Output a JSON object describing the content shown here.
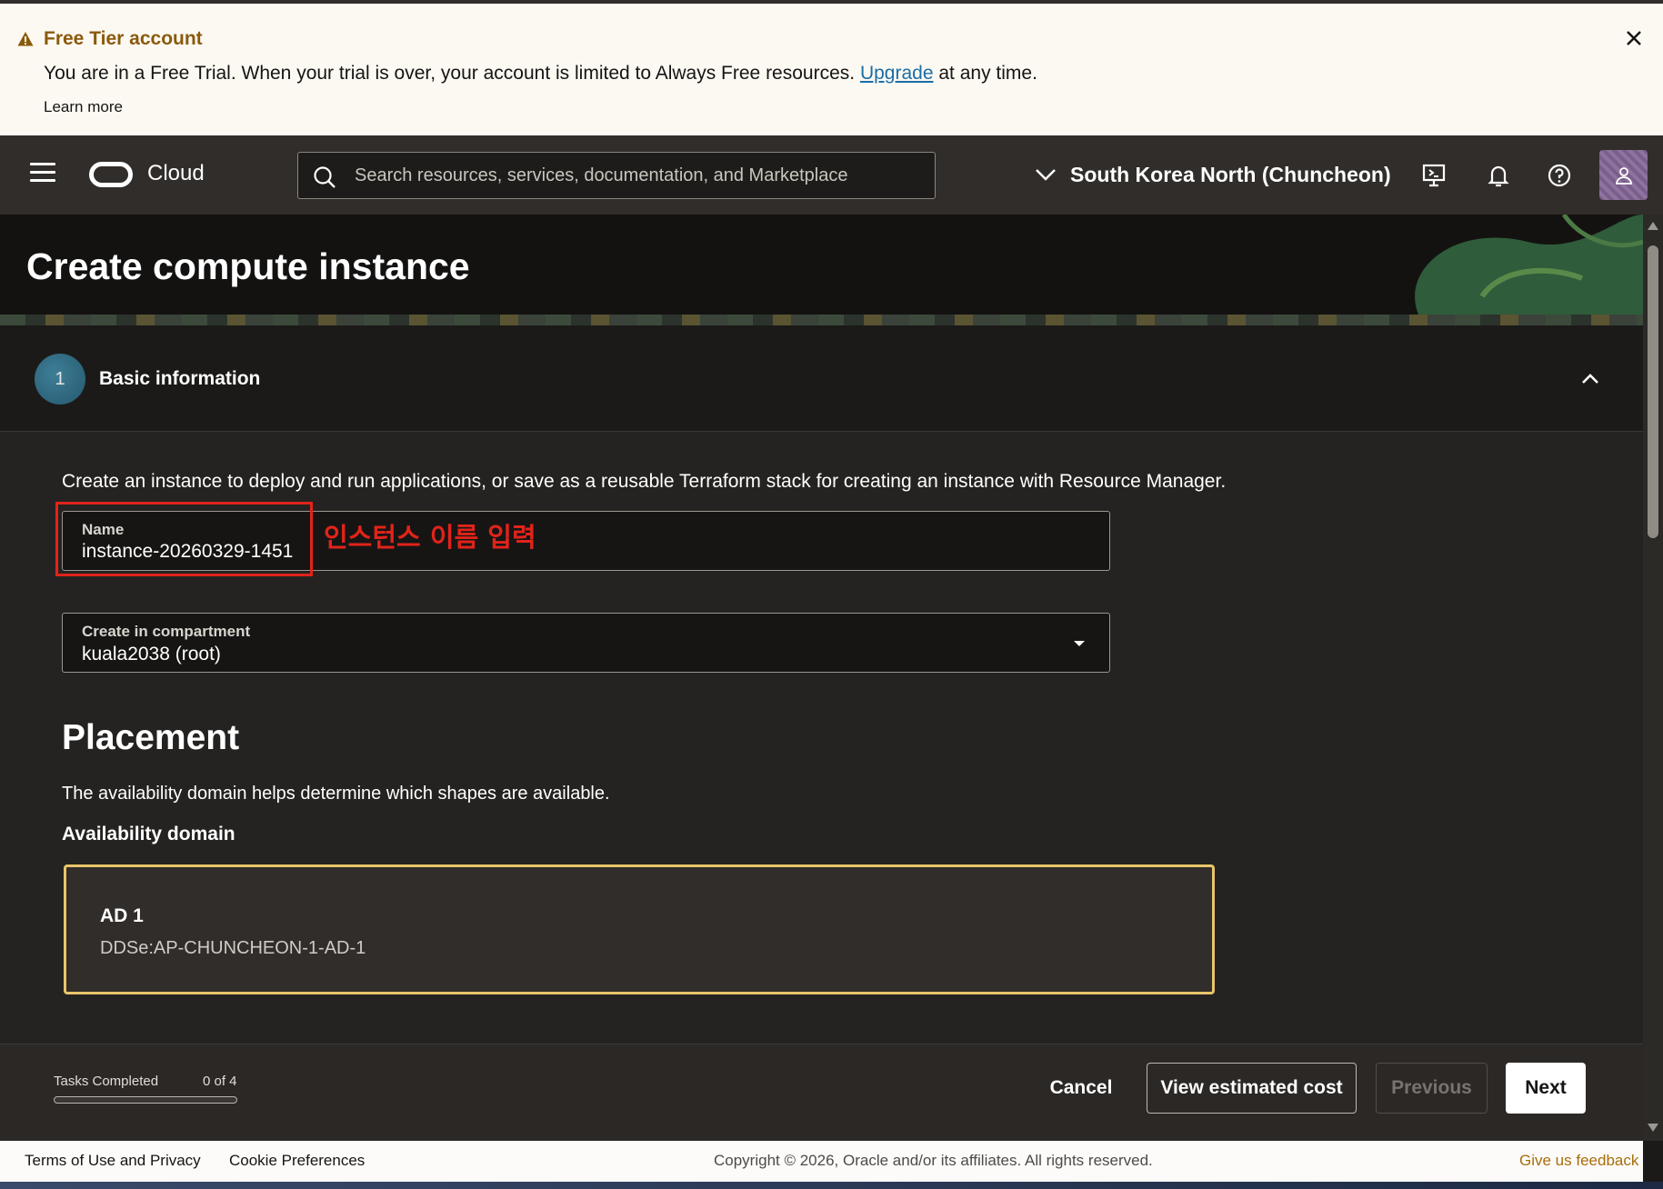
{
  "banner": {
    "title": "Free Tier account",
    "message_before": "You are in a Free Trial. When your trial is over, your account is limited to Always Free resources.",
    "upgrade_link": "Upgrade",
    "message_after": "at any time.",
    "learn_more": "Learn more"
  },
  "header": {
    "brand": "Cloud",
    "search_placeholder": "Search resources, services, documentation, and Marketplace",
    "region": "South Korea North (Chuncheon)"
  },
  "page": {
    "title": "Create compute instance"
  },
  "section": {
    "step_number": "1",
    "label": "Basic information"
  },
  "form": {
    "intro": "Create an instance to deploy and run applications, or save as a reusable Terraform stack for creating an instance with Resource Manager.",
    "name_label": "Name",
    "name_value": "instance-20260329-1451",
    "annotation": "인스턴스 이름 입력",
    "compartment_label": "Create in compartment",
    "compartment_value": "kuala2038 (root)"
  },
  "placement": {
    "heading": "Placement",
    "description": "The availability domain helps determine which shapes are available.",
    "ad_label": "Availability domain",
    "ad_name": "AD 1",
    "ad_id": "DDSe:AP-CHUNCHEON-1-AD-1"
  },
  "actions": {
    "tasks_label": "Tasks Completed",
    "tasks_count": "0 of 4",
    "tasks_fraction": 0,
    "cancel": "Cancel",
    "view_cost": "View estimated cost",
    "previous": "Previous",
    "next": "Next"
  },
  "footer": {
    "terms": "Terms of Use and Privacy",
    "cookies": "Cookie Preferences",
    "copyright": "Copyright © 2026, Oracle and/or its affiliates. All rights reserved.",
    "feedback": "Give us feedback"
  },
  "colors": {
    "accent_gold": "#e9c46a",
    "annotation_red": "#e2231a",
    "header_bg": "#312d2a"
  },
  "icons": [
    "warning-icon",
    "close-icon",
    "hamburger-icon",
    "oracle-logo",
    "search-icon",
    "chevron-down-icon",
    "cloud-shell-icon",
    "bell-icon",
    "help-icon",
    "user-icon",
    "chevron-up-icon",
    "caret-down-icon"
  ]
}
